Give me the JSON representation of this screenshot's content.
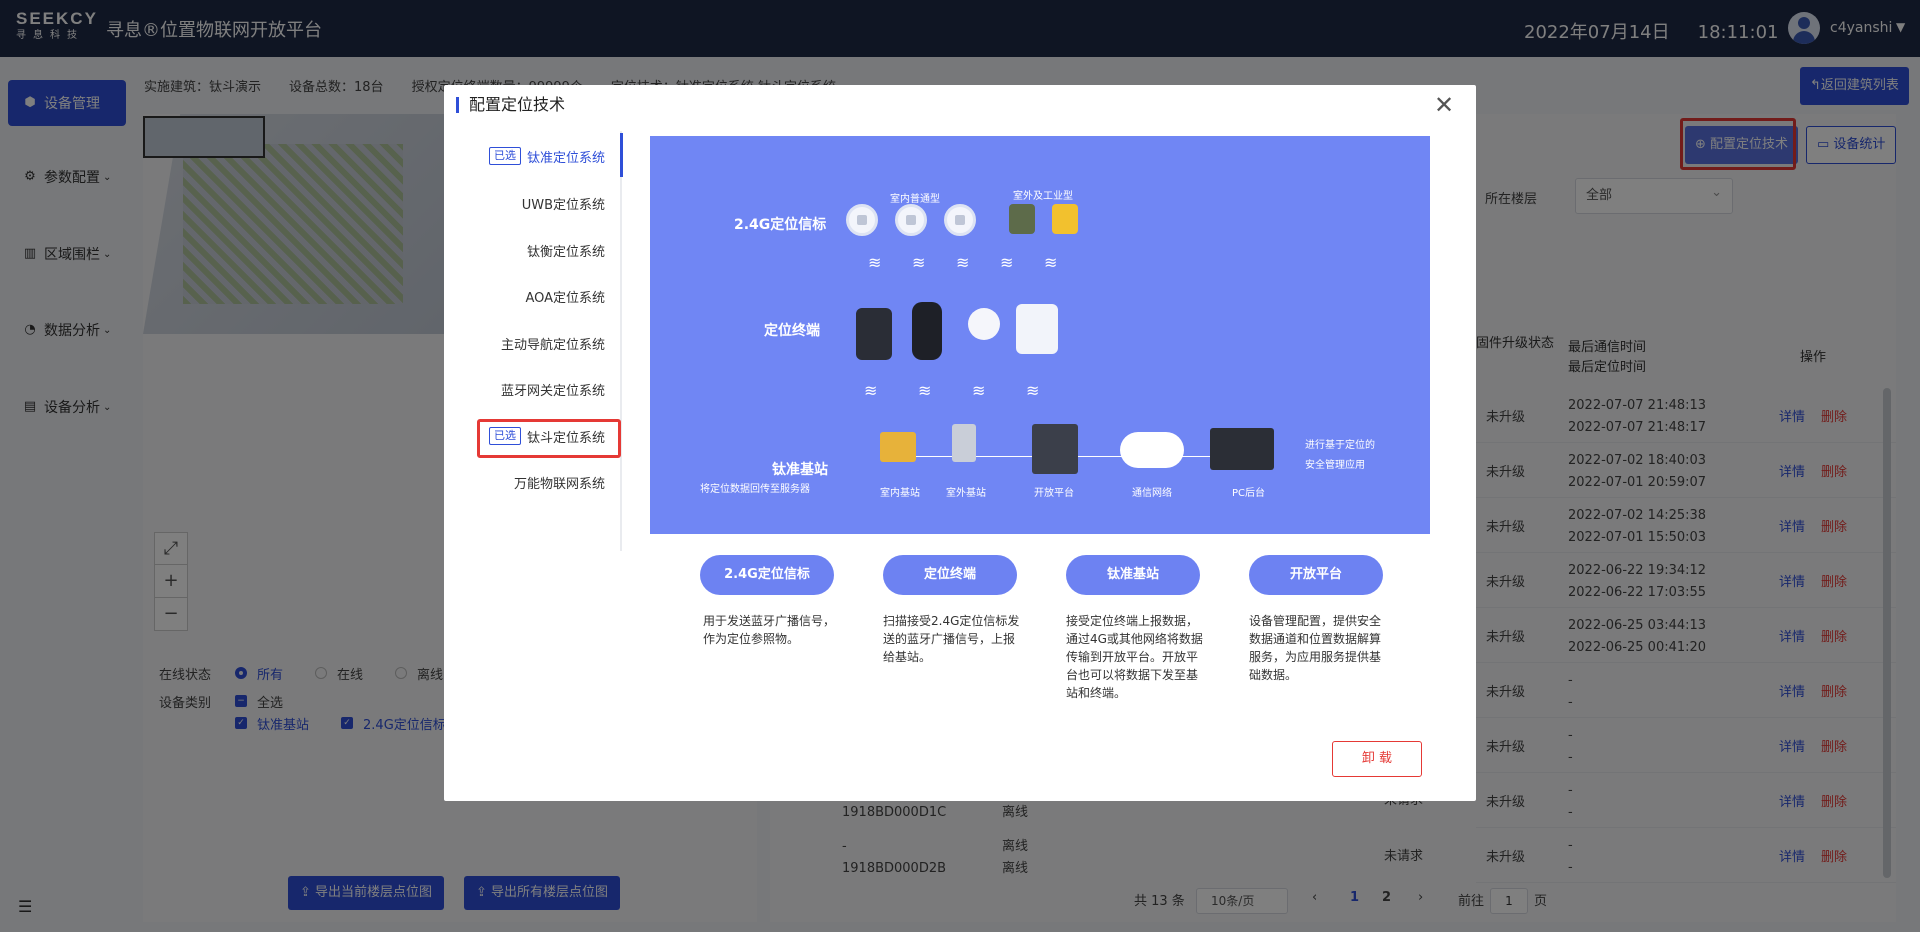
{
  "header": {
    "logo_text": "SEEKCY",
    "logo_sub": "寻息科技",
    "platform_title": "寻息®位置物联网开放平台",
    "date": "2022年07月14日",
    "time": "18:11:01",
    "username": "c4yanshi"
  },
  "sidebar": {
    "items": [
      {
        "label": "设备管理",
        "icon": "device-icon"
      },
      {
        "label": "参数配置",
        "icon": "settings-icon"
      },
      {
        "label": "区域围栏",
        "icon": "fence-icon"
      },
      {
        "label": "数据分析",
        "icon": "pie-icon"
      },
      {
        "label": "设备分析",
        "icon": "analysis-icon"
      }
    ]
  },
  "info_strip": {
    "building": "实施建筑：钛斗演示",
    "device_total": "设备总数：18台",
    "terminal_count": "授权定位终端数量：99999个",
    "tech": "定位技术：钛准定位系统 钛斗定位系统"
  },
  "toolbar": {
    "back_label": "返回建筑列表",
    "config_label": "配置定位技术",
    "stats_label": "设备统计",
    "floor_label": "所在楼层",
    "floor_value": "全部"
  },
  "filters": {
    "online_label": "在线状态",
    "online_options": [
      "所有",
      "在线",
      "离线"
    ],
    "type_label": "设备类别",
    "select_all": "全选",
    "types": [
      "钛准基站",
      "2.4G定位信标"
    ]
  },
  "export": {
    "current_floor": "导出当前楼层点位图",
    "all_floors": "导出所有楼层点位图"
  },
  "table": {
    "col_upgrade": "固件升级状态",
    "col_last_comm": "最后通信时间",
    "col_last_loc": "最后定位时间",
    "col_ops": "操作",
    "detail": "详情",
    "delete": "删除",
    "rows": [
      {
        "status": "未升级",
        "t1": "2022-07-07 21:48:13",
        "t2": "2022-07-07 21:48:17"
      },
      {
        "status": "未升级",
        "t1": "2022-07-02 18:40:03",
        "t2": "2022-07-01 20:59:07"
      },
      {
        "status": "未升级",
        "t1": "2022-07-02 14:25:38",
        "t2": "2022-07-01 15:50:03"
      },
      {
        "status": "未升级",
        "t1": "2022-06-22 19:34:12",
        "t2": "2022-06-22 17:03:55"
      },
      {
        "status": "未升级",
        "t1": "2022-06-25 03:44:13",
        "t2": "2022-06-25 00:41:20"
      },
      {
        "status": "未升级",
        "t1": "-",
        "t2": "-"
      },
      {
        "status": "未升级",
        "t1": "-",
        "t2": "-"
      },
      {
        "status": "未升级",
        "t1": "-",
        "t2": "-"
      },
      {
        "status": "未升级",
        "t1": "-",
        "t2": "-"
      }
    ],
    "left_rows": [
      {
        "id": "1918BD000D1C",
        "state": "离线",
        "dash": "-",
        "req": "未请求"
      },
      {
        "id": "1918BD000D2B",
        "state": "离线",
        "dash": "-",
        "req": "未请求"
      }
    ]
  },
  "pagination": {
    "total": "共 13 条",
    "page_size": "10条/页",
    "page1": "1",
    "page2": "2",
    "goto": "前往",
    "goto_value": "1",
    "page_unit": "页"
  },
  "modal": {
    "title": "配置定位技术",
    "selected_tag": "已选",
    "systems": [
      "钛准定位系统",
      "UWB定位系统",
      "钛衡定位系统",
      "AOA定位系统",
      "主动导航定位系统",
      "蓝牙网关定位系统",
      "钛斗定位系统",
      "万能物联网系统"
    ],
    "selected_flags": [
      true,
      false,
      false,
      false,
      false,
      false,
      true,
      false
    ],
    "uninstall": "卸 载",
    "diagram": {
      "beacon_title": "2.4G定位信标",
      "beacon_indoor": "室内普通型",
      "beacon_outdoor": "室外及工业型",
      "terminal_title": "定位终端",
      "station_title": "钛准基站",
      "station_sub": "将定位数据回传至服务器",
      "indoor_station": "室内基站",
      "outdoor_station": "室外基站",
      "open_platform": "开放平台",
      "network": "通信网络",
      "pc": "PC后台",
      "app_line1": "进行基于定位的",
      "app_line2": "安全管理应用"
    },
    "features": [
      {
        "title": "2.4G定位信标",
        "desc": "用于发送蓝牙广播信号，作为定位参照物。"
      },
      {
        "title": "定位终端",
        "desc": "扫描接受2.4G定位信标发送的蓝牙广播信号，上报给基站。"
      },
      {
        "title": "钛准基站",
        "desc": "接受定位终端上报数据，通过4G或其他网络将数据传输到开放平台。开放平台也可以将数据下发至基站和终端。"
      },
      {
        "title": "开放平台",
        "desc": "设备管理配置，提供安全数据通道和位置数据解算服务，为应用服务提供基础数据。"
      }
    ]
  },
  "colors": {
    "primary": "#2f4fd8",
    "header_bg": "#1f2a47",
    "danger": "#e53935",
    "diagram_bg": "#7086f4"
  }
}
